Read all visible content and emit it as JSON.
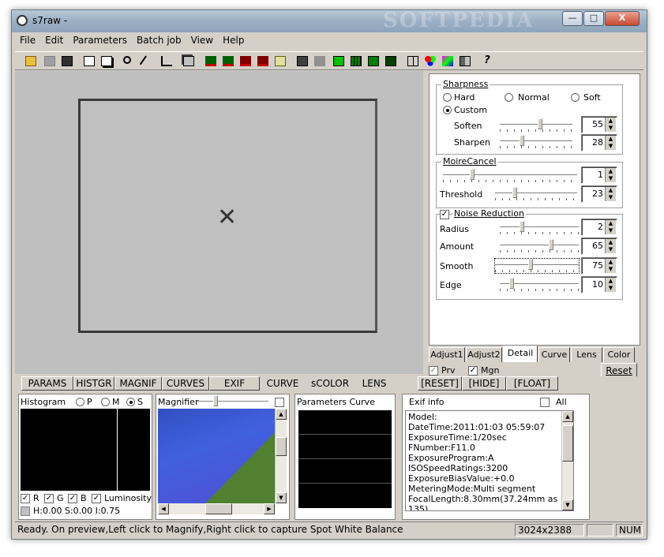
{
  "window": {
    "title": "s7raw -",
    "watermark": "SOFTPEDIA",
    "min": "—",
    "max": "□",
    "close": "X"
  },
  "menu": [
    "File",
    "Edit",
    "Parameters",
    "Batch job",
    "View",
    "Help"
  ],
  "toolbar": {
    "icons": [
      "open-icon",
      "save-disabled-icon",
      "save-icon",
      "copy-icon",
      "paste-icon",
      "zoom-icon",
      "eyedropper-icon",
      "crop-icon",
      "stack-icon",
      "psd16-icon",
      "psd8-icon",
      "tiff16-icon",
      "tiff8-icon",
      "jpeg-icon",
      "layers-icon",
      "blank-icon",
      "green-square-icon",
      "green-grid-icon",
      "green-quad-icon",
      "preview-icon",
      "grid-icon",
      "rgb-icon",
      "color-pick-icon",
      "split-icon",
      "help-icon"
    ],
    "accent": "#00a000"
  },
  "sharpness": {
    "legend": "Sharpness",
    "options": [
      "Hard",
      "Normal",
      "Soft",
      "Custom"
    ],
    "selected": "Custom",
    "soften_label": "Soften",
    "soften_value": "55",
    "sharpen_label": "Sharpen",
    "sharpen_value": "28"
  },
  "moire": {
    "legend": "MoireCancel",
    "value": "1",
    "threshold_label": "Threshold",
    "threshold_value": "23"
  },
  "noise": {
    "legend": "Noise Reduction",
    "checked": true,
    "radius_label": "Radius",
    "radius_value": "2",
    "amount_label": "Amount",
    "amount_value": "65",
    "smooth_label": "Smooth",
    "smooth_value": "75",
    "edge_label": "Edge",
    "edge_value": "10"
  },
  "right_tabs": [
    "Adjust1",
    "Adjust2",
    "Detail",
    "Curve",
    "Lens",
    "Color"
  ],
  "right_active": "Detail",
  "prv_label": "Prv",
  "mgn_label": "Mgn",
  "reset_label": "Reset",
  "bottom_tabs": [
    "PARAMS",
    "HISTGR",
    "MAGNIF",
    "CURVES",
    "EXIF"
  ],
  "bottom_flat_tabs": [
    "CURVE",
    "sCOLOR",
    "LENS"
  ],
  "bottom_buttons": [
    "[RESET]",
    "[HIDE]",
    "[FLOAT]"
  ],
  "histogram": {
    "title": "Histogram",
    "modes": [
      "P",
      "M",
      "S"
    ],
    "mode_selected": "S",
    "channels": [
      "R",
      "G",
      "B",
      "Luminosity"
    ],
    "readout": "H:0.00 S:0.00 I:0.75"
  },
  "magnifier": {
    "title": "Magnifier"
  },
  "params_curve": {
    "title": "Parameters Curve"
  },
  "exif": {
    "title": "Exif info",
    "all_label": "All",
    "lines": [
      "Model:",
      "DateTime:2011:01:03 05:59:07",
      "ExposureTime:1/20sec",
      "FNumber:F11.0",
      "ExposureProgram:A",
      "ISOSpeedRatings:3200",
      "ExposureBiasValue:+0.0",
      "MeteringMode:Multi segment",
      "FocalLength:8.30mm(37.24mm as 135)"
    ]
  },
  "status": {
    "message": "Ready. On preview,Left click to Magnify,Right click to capture Spot White Balance",
    "dimensions": "3024x2388",
    "num": "NUM"
  }
}
